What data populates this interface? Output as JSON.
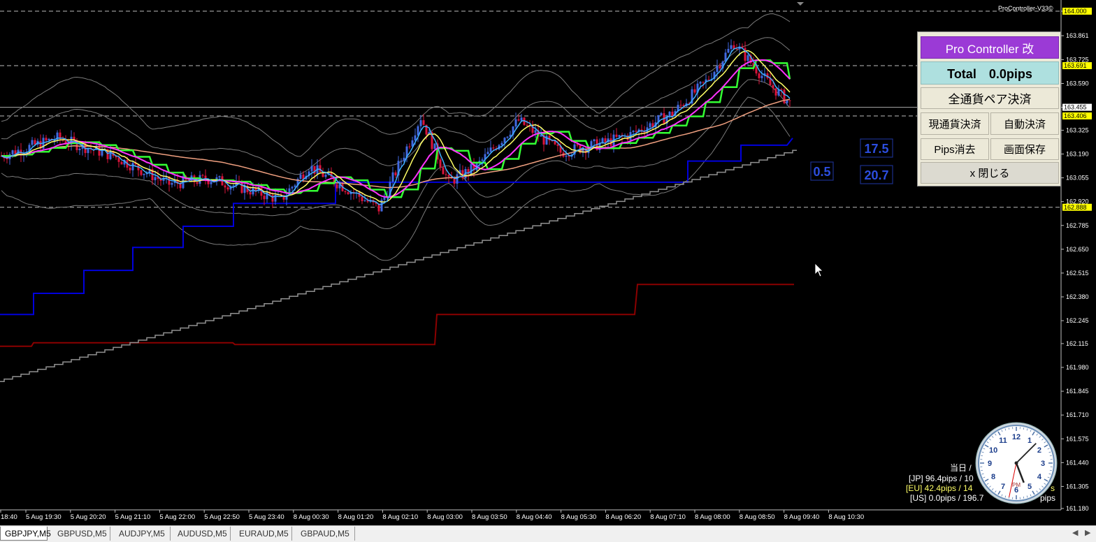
{
  "indicator_label": "ProController-V33©",
  "price_axis": {
    "ticks": [
      "164.000",
      "163.861",
      "163.725",
      "163.590",
      "163.455",
      "163.325",
      "163.190",
      "163.055",
      "162.920",
      "162.785",
      "162.650",
      "162.515",
      "162.380",
      "162.245",
      "162.115",
      "161.980",
      "161.845",
      "161.710",
      "161.575",
      "161.440",
      "161.305",
      "161.180"
    ],
    "markers": [
      {
        "label": "164.000",
        "y_value": 164.0,
        "bg": "#ffff00"
      },
      {
        "label": "163.691",
        "y_value": 163.691,
        "bg": "#ffff00"
      },
      {
        "label": "163.455",
        "y_value": 163.455,
        "bg": "#ffffff"
      },
      {
        "label": "163.406",
        "y_value": 163.406,
        "bg": "#ffff00"
      },
      {
        "label": "162.888",
        "y_value": 162.888,
        "bg": "#ffff00"
      }
    ]
  },
  "time_axis": {
    "ticks": [
      "18:40",
      "5 Aug 19:30",
      "5 Aug 20:20",
      "5 Aug 21:10",
      "5 Aug 22:00",
      "5 Aug 22:50",
      "5 Aug 23:40",
      "8 Aug 00:30",
      "8 Aug 01:20",
      "8 Aug 02:10",
      "8 Aug 03:00",
      "8 Aug 03:50",
      "8 Aug 04:40",
      "8 Aug 05:30",
      "8 Aug 06:20",
      "8 Aug 07:10",
      "8 Aug 08:00",
      "8 Aug 08:50",
      "8 Aug 09:40",
      "8 Aug 10:30"
    ]
  },
  "boxes": [
    {
      "label": "0.5"
    },
    {
      "label": "17.5"
    },
    {
      "label": "20.7"
    }
  ],
  "panel": {
    "title": "Pro Controller 改",
    "total": "Total　0.0pips",
    "close_all": "全通貨ペア決済",
    "close_current": "現通貨決済",
    "auto_close": "自動決済",
    "clear_pips": "Pips消去",
    "save_screen": "画面保存",
    "close": "x 閉じる"
  },
  "session_stats": {
    "header": "当日 /",
    "jp": "[JP] 96.4pips / 10",
    "eu": "[EU] 42.4pips / 14",
    "us": "[US] 0.0pips / 196.7",
    "eu_suffix": "s",
    "us_suffix": "pips"
  },
  "clock": {
    "numbers": [
      "12",
      "1",
      "2",
      "3",
      "4",
      "5",
      "6",
      "7",
      "8",
      "9",
      "10",
      "11"
    ],
    "ampm": "PM",
    "hour_hand_deg": 159,
    "minute_hand_deg": 45,
    "second_hand_deg": 192
  },
  "tabs": [
    "GBPJPY,M5",
    "GBPUSD,M5",
    "AUDJPY,M5",
    "AUDUSD,M5",
    "EURAUD,M5",
    "GBPAUD,M5"
  ],
  "colors": {
    "background": "#000000",
    "bull_candle": "#4169e1",
    "bear_candle": "#dc143c",
    "ma_fast": "#40b0ff",
    "ma_yellow": "#ffff66",
    "ma_magenta": "#ff33ff",
    "ma_green": "#33ff33",
    "ma_salmon": "#f0a080",
    "blue_step": "#0000dd",
    "red_step": "#8b0000",
    "gray_step": "#909090",
    "bands": "#808080"
  }
}
